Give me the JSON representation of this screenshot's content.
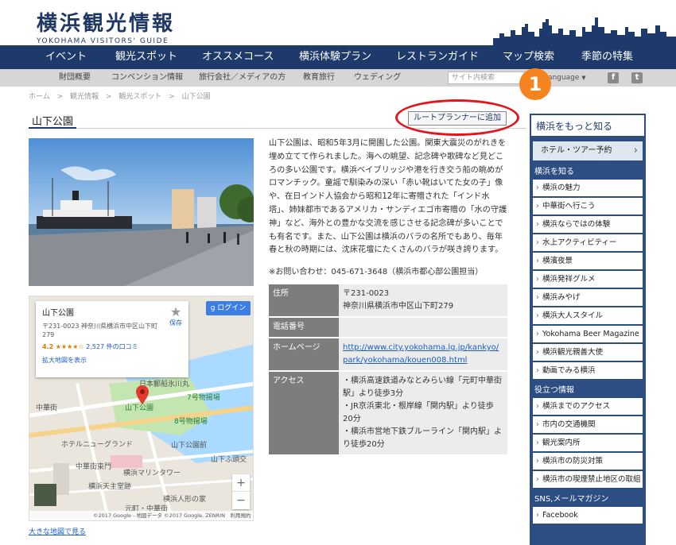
{
  "brand": {
    "title_jp": "横浜観光情報",
    "title_en": "YOKOHAMA VISITORS' GUIDE"
  },
  "nav": [
    "イベント",
    "観光スポット",
    "オススメコース",
    "横浜体験プラン",
    "レストランガイド",
    "マップ検索",
    "季節の特集"
  ],
  "subnav": {
    "items": [
      "財団概要",
      "コンベンション情報",
      "旅行会社／メディアの方",
      "教育旅行",
      "ウェディング"
    ],
    "search_placeholder": "サイト内検索",
    "language": "Language",
    "sns": [
      "f",
      "t"
    ]
  },
  "breadcrumbs": [
    "ホーム",
    ">",
    "観光情報",
    ">",
    "観光スポット",
    ">",
    "山下公園"
  ],
  "page": {
    "title": "山下公園",
    "add_route_button": "ルートプランナーに追加",
    "badge": "1",
    "description": "山下公園は、昭和5年3月に開園した公園。関東大震災のがれきを埋め立てて作られました。海への眺望、記念碑や歌碑など見どころの多い公園です。横浜ベイブリッジや港を行き交う船の眺めがロマンチック。童謡で馴染みの深い「赤い靴はいてた女の子」像や、在日インド人協会から昭和12年に寄贈された「インド水塔」、姉妹都市であるアメリカ・サンディエゴ市寄贈の「水の守護神」など、海外との豊かな交流を感じさせる記念碑が多いことでも有名です。また、山下公園は横浜のバラの名所でもあり、毎年春と秋の時期には、沈床花壇にたくさんのバラが咲き誇ります。",
    "contact": "※お問い合わせ：045-671-3648（横浜市都心部公園担当）"
  },
  "info": {
    "address_label": "住所",
    "address_zip": "〒231-0023",
    "address": "神奈川県横浜市中区山下町279",
    "phone_label": "電話番号",
    "phone": "",
    "homepage_label": "ホームページ",
    "homepage_url": "http://www.city.yokohama.lg.jp/kankyo/park/yokohama/kouen008.html",
    "access_label": "アクセス",
    "access": [
      "・横浜高速鉄道みなとみらい線「元町中華街駅」より徒歩3分",
      "・JR京浜東北・根岸線「関内駅」より徒歩20分",
      "・横浜市営地下鉄ブルーライン「関内駅」より徒歩20分"
    ]
  },
  "map": {
    "card_name": "山下公園",
    "card_address": "〒231-0023 神奈川県横浜市中区山下町279",
    "rating": "4.2",
    "stars": "★★★★☆",
    "reviews": "2,527 件の口コミ",
    "enlarge": "拡大地図を表示",
    "save": "保存",
    "login": "g ログイン",
    "labels": [
      "日本郵船氷川丸",
      "7号物揚場",
      "山下公園",
      "8号物揚場",
      "ホテルニューグランド",
      "山下公園前",
      "山下ふ頭交",
      "中華街東門",
      "横浜マリンタワー",
      "横浜天主堂跡",
      "横浜人形の家",
      "元町・中華街",
      "中華街"
    ],
    "zoom_in": "+",
    "zoom_out": "−",
    "footer": "©2017 Google - 地図データ ©2017 Google, ZENRIN　利用規約",
    "big_map_link": "大きな地図で見る"
  },
  "sidebar": {
    "heading": "横浜をもっと知る",
    "hotel": "ホテル・ツアー予約",
    "section1": "横浜を知る",
    "links1": [
      "横浜の魅力",
      "中華街へ行こう",
      "横浜ならではの体験",
      "水上アクティビティー",
      "横濱夜景",
      "横浜発祥グルメ",
      "横浜みやげ",
      "横浜大人スタイル",
      "Yokohama Beer Magazine",
      "横浜観光親善大使",
      "動画でみる横浜"
    ],
    "section2": "役立つ情報",
    "links2": [
      "横浜までのアクセス",
      "市内の交通機関",
      "観光案内所",
      "横浜市の防災対策",
      "横浜市の喫煙禁止地区の取組"
    ],
    "section3": "SNS,メールマガジン",
    "links3": [
      "Facebook"
    ]
  }
}
